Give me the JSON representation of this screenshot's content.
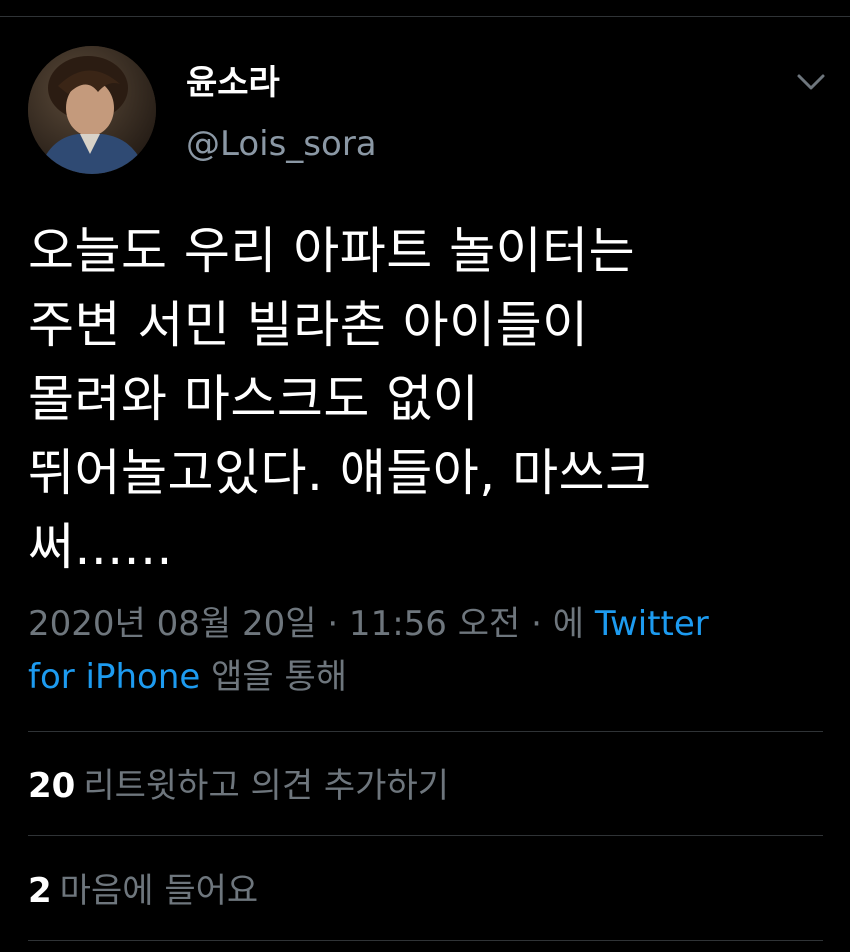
{
  "tweet": {
    "author": {
      "display_name": "윤소라",
      "handle": "@Lois_sora"
    },
    "text_lines": [
      "오늘도 우리 아파트 놀이터는",
      "주변 서민 빌라촌 아이들이",
      "몰려와 마스크도 없이",
      "뛰어놀고있다. 얘들아, 마쓰크",
      "써......"
    ],
    "timestamp": "2020년 08월 20일 · 11:56 오전 · 에",
    "source_link": "Twitter",
    "source_link_cont": "for iPhone",
    "source_suffix": "앱을 통해",
    "stats": {
      "retweets_count": "20",
      "retweets_label": "리트윗하고 의견 추가하기",
      "likes_count": "2",
      "likes_label": "마음에 들어요"
    },
    "menu_icon": "chevron-down-icon"
  },
  "colors": {
    "background": "#000000",
    "primary_text": "#ffffff",
    "secondary_text": "#6e767d",
    "link": "#1d9bf0",
    "divider": "#2f3336"
  }
}
